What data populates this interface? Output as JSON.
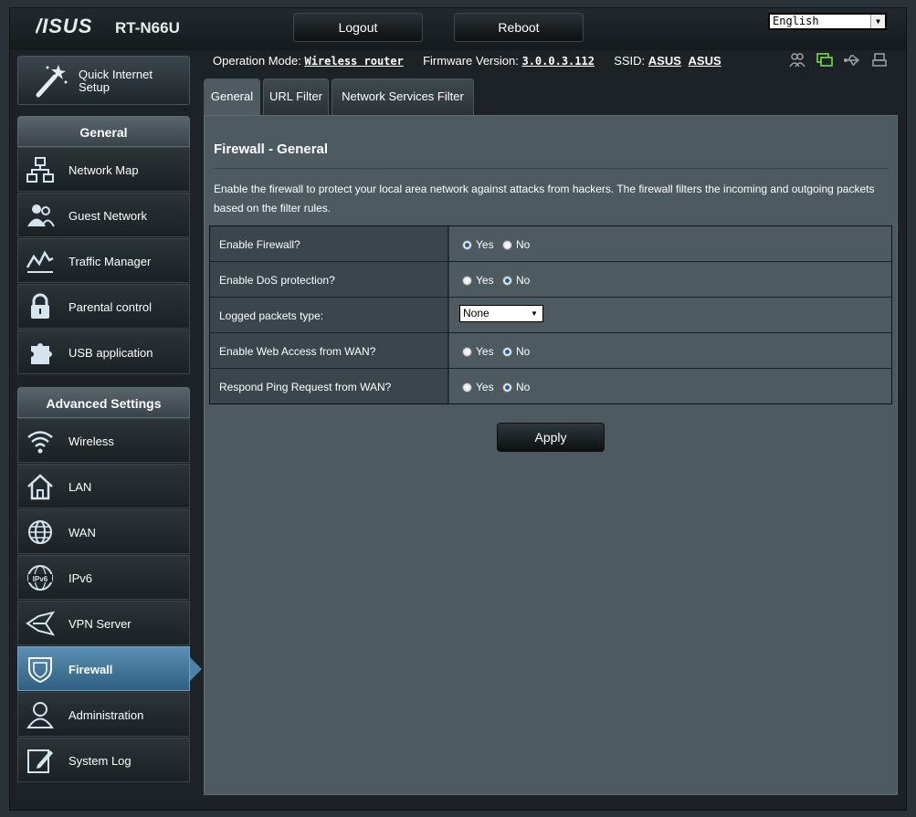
{
  "header": {
    "logo": "/ISUS",
    "model": "RT-N66U",
    "logout_label": "Logout",
    "reboot_label": "Reboot",
    "language": "English"
  },
  "status": {
    "operation_mode_label": "Operation Mode:",
    "operation_mode_value": "Wireless router",
    "firmware_label": "Firmware Version:",
    "firmware_value": "3.0.0.3.112",
    "ssid_label": "SSID:",
    "ssid_value_1": "ASUS",
    "ssid_value_2": "ASUS",
    "icon_active_color": "#6fe04d",
    "icon_inactive_color": "#9aa3a8"
  },
  "sidebar": {
    "quick_setup_label": "Quick Internet Setup",
    "general_header": "General",
    "general_items": [
      {
        "label": "Network Map",
        "icon": "network-map-icon"
      },
      {
        "label": "Guest Network",
        "icon": "guest-network-icon"
      },
      {
        "label": "Traffic Manager",
        "icon": "traffic-manager-icon"
      },
      {
        "label": "Parental control",
        "icon": "parental-control-icon"
      },
      {
        "label": "USB application",
        "icon": "usb-application-icon"
      }
    ],
    "advanced_header": "Advanced Settings",
    "advanced_items": [
      {
        "label": "Wireless",
        "icon": "wireless-icon"
      },
      {
        "label": "LAN",
        "icon": "lan-icon"
      },
      {
        "label": "WAN",
        "icon": "wan-icon"
      },
      {
        "label": "IPv6",
        "icon": "ipv6-icon"
      },
      {
        "label": "VPN Server",
        "icon": "vpn-server-icon"
      },
      {
        "label": "Firewall",
        "icon": "firewall-icon",
        "active": true
      },
      {
        "label": "Administration",
        "icon": "administration-icon"
      },
      {
        "label": "System Log",
        "icon": "system-log-icon"
      }
    ]
  },
  "tabs": [
    {
      "label": "General",
      "active": true
    },
    {
      "label": "URL Filter"
    },
    {
      "label": "Network Services Filter"
    }
  ],
  "main": {
    "title": "Firewall - General",
    "description": "Enable the firewall to protect your local area network against attacks from hackers. The firewall filters the incoming and outgoing packets based on the filter rules.",
    "yes_label": "Yes",
    "no_label": "No",
    "settings": [
      {
        "label": "Enable Firewall?",
        "type": "radio",
        "value": "Yes"
      },
      {
        "label": "Enable DoS protection?",
        "type": "radio",
        "value": "No"
      },
      {
        "label": "Logged packets type:",
        "type": "select",
        "value": "None"
      },
      {
        "label": "Enable Web Access from WAN?",
        "type": "radio",
        "value": "No"
      },
      {
        "label": "Respond Ping Request from WAN?",
        "type": "radio",
        "value": "No"
      }
    ],
    "apply_label": "Apply"
  }
}
